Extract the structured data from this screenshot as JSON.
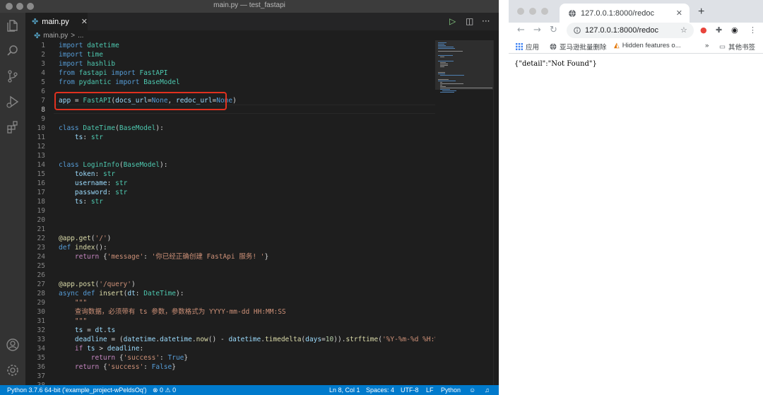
{
  "vscode": {
    "window_title": "main.py — test_fastapi",
    "tab_label": "main.py",
    "breadcrumb": {
      "file": "main.py",
      "sep": ">",
      "rest": "..."
    },
    "status_bar": {
      "interpreter": "Python 3.7.6 64-bit ('example_project-wPeldsOq')",
      "problems": "⊗ 0 ⚠ 0",
      "cursor": "Ln 8, Col 1",
      "indent": "Spaces: 4",
      "encoding": "UTF-8",
      "eol": "LF",
      "language": "Python"
    },
    "icons": [
      "files-icon",
      "search-icon",
      "source-control-icon",
      "run-debug-icon",
      "extensions-icon",
      "account-icon",
      "settings-gear-icon",
      "run-icon",
      "split-editor-icon",
      "more-actions-icon",
      "feedback-icon",
      "bell-icon"
    ]
  },
  "code_lines": [
    {
      "n": "1",
      "t": "import datetime"
    },
    {
      "n": "2",
      "t": "import time"
    },
    {
      "n": "3",
      "t": "import hashlib"
    },
    {
      "n": "4",
      "t": "from fastapi import FastAPI"
    },
    {
      "n": "5",
      "t": "from pydantic import BaseModel"
    },
    {
      "n": "6",
      "t": ""
    },
    {
      "n": "7",
      "t": "app = FastAPI(docs_url=None, redoc_url=None)"
    },
    {
      "n": "8",
      "t": ""
    },
    {
      "n": "9",
      "t": ""
    },
    {
      "n": "10",
      "t": "class DateTime(BaseModel):"
    },
    {
      "n": "11",
      "t": "    ts: str"
    },
    {
      "n": "12",
      "t": ""
    },
    {
      "n": "13",
      "t": ""
    },
    {
      "n": "14",
      "t": "class LoginInfo(BaseModel):"
    },
    {
      "n": "15",
      "t": "    token: str"
    },
    {
      "n": "16",
      "t": "    username: str"
    },
    {
      "n": "17",
      "t": "    password: str"
    },
    {
      "n": "18",
      "t": "    ts: str"
    },
    {
      "n": "19",
      "t": ""
    },
    {
      "n": "20",
      "t": ""
    },
    {
      "n": "21",
      "t": ""
    },
    {
      "n": "22",
      "t": "@app.get('/')"
    },
    {
      "n": "23",
      "t": "def index():"
    },
    {
      "n": "24",
      "t": "    return {'message': '你已经正确创建 FastApi 服务! '}"
    },
    {
      "n": "25",
      "t": ""
    },
    {
      "n": "26",
      "t": ""
    },
    {
      "n": "27",
      "t": "@app.post('/query')"
    },
    {
      "n": "28",
      "t": "async def insert(dt: DateTime):"
    },
    {
      "n": "29",
      "t": "    \"\"\""
    },
    {
      "n": "30",
      "t": "    查询数据，必须带有 ts 参数，参数格式为 YYYY-mm-dd HH:MM:SS"
    },
    {
      "n": "31",
      "t": "    \"\"\""
    },
    {
      "n": "32",
      "t": "    ts = dt.ts"
    },
    {
      "n": "33",
      "t": "    deadline = (datetime.datetime.now() - datetime.timedelta(days=10)).strftime('%Y-%m-%d %H:%M:%S')"
    },
    {
      "n": "34",
      "t": "    if ts > deadline:"
    },
    {
      "n": "35",
      "t": "        return {'success': True}"
    },
    {
      "n": "36",
      "t": "    return {'success': False}"
    },
    {
      "n": "37",
      "t": ""
    },
    {
      "n": "38",
      "t": ""
    }
  ],
  "chrome": {
    "tab_title": "127.0.0.1:8000/redoc",
    "url": "127.0.0.1:8000/redoc",
    "bookmarks": {
      "apps": "应用",
      "item1": "亚马逊批量删除",
      "item2": "Hidden features o...",
      "overflow": "»",
      "other": "其他书签"
    },
    "page_text": "{\"detail\":\"Not Found\"}",
    "icons": [
      "back-icon",
      "forward-icon",
      "reload-icon",
      "lock-icon",
      "star-icon",
      "close-icon",
      "new-tab-icon",
      "extension-icon",
      "puzzle-icon",
      "profile-icon",
      "menu-icon",
      "apps-grid-icon",
      "folder-icon"
    ]
  },
  "colors": {
    "status_bar": "#007acc",
    "highlight_box": "#e0311f",
    "editor_bg": "#1e1e1e"
  }
}
